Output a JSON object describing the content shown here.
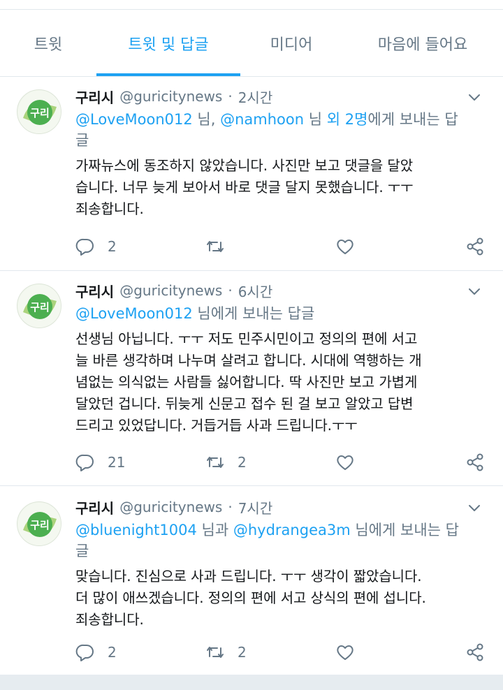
{
  "tabs": [
    {
      "label": "트윗",
      "active": false
    },
    {
      "label": "트윗 및 답글",
      "active": true
    },
    {
      "label": "미디어",
      "active": false
    },
    {
      "label": "마음에 들어요",
      "active": false
    }
  ],
  "colors": {
    "accent": "#1da1f2",
    "muted": "#657786",
    "text": "#14171a",
    "divider": "#e1e8ed",
    "avatar_green": "#4caf50"
  },
  "avatar_text": "구리",
  "tweets": [
    {
      "name": "구리시",
      "handle": "@guricitynews",
      "dot": "·",
      "time": "2시간",
      "reply": {
        "mention1": "@LoveMoon012",
        "sep1": " 님, ",
        "mention2": "@namhoon",
        "sep2": " 님 ",
        "extra": "외 2명",
        "suffix": "에게 보내는 답",
        "line2": "글"
      },
      "lines": [
        "가짜뉴스에 동조하지 않았습니다. 사진만 보고 댓글을 달았",
        "습니다. 너무 늦게 보아서 바로 댓글 달지 못했습니다. ㅜㅜ",
        "죄송합니다."
      ],
      "replies": "2",
      "retweets": "",
      "likes": ""
    },
    {
      "name": "구리시",
      "handle": "@guricitynews",
      "dot": "·",
      "time": "6시간",
      "reply": {
        "mention1": "@LoveMoon012",
        "suffix": " 님에게 보내는 답글"
      },
      "lines": [
        "선생님 아닙니다. ㅜㅜ 저도 민주시민이고 정의의 편에 서고",
        "늘 바른 생각하며 나누며 살려고 합니다. 시대에 역행하는 개",
        "념없는 의식없는 사람들 싫어합니다. 딱 사진만 보고 가볍게",
        "달았던 겁니다.  뒤늦게 신문고 접수 된 걸 보고 알았고 답변",
        "드리고 있었답니다. 거듭거듭 사과 드립니다.ㅜㅜ"
      ],
      "replies": "21",
      "retweets": "2",
      "likes": ""
    },
    {
      "name": "구리시",
      "handle": "@guricitynews",
      "dot": "·",
      "time": "7시간",
      "reply": {
        "mention1": "@bluenight1004",
        "sep1": " 님과 ",
        "mention2": "@hydrangea3m",
        "suffix": " 님에게 보내는 답",
        "line2": "글"
      },
      "lines": [
        "맞습니다. 진심으로 사과 드립니다. ㅜㅜ 생각이 짧았습니다.",
        "더 많이 애쓰겠습니다. 정의의 편에 서고 상식의 편에 섭니다.",
        "죄송합니다."
      ],
      "replies": "2",
      "retweets": "2",
      "likes": ""
    }
  ]
}
